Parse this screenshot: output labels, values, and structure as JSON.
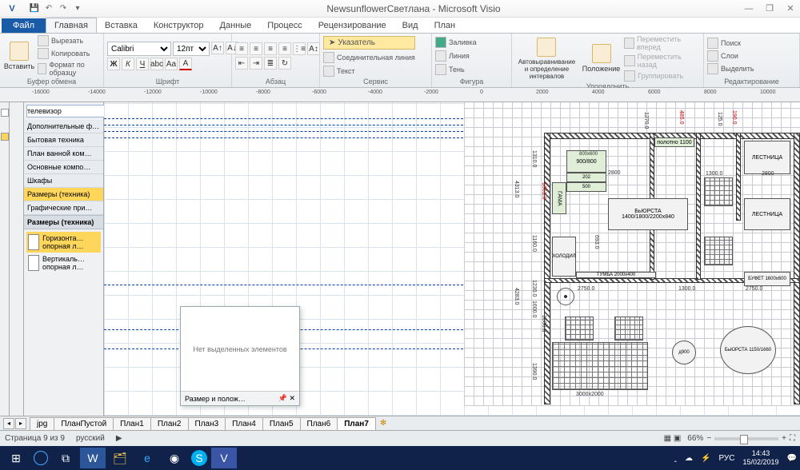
{
  "title": "NewsunflowerСветлана - Microsoft Visio",
  "file_tab": "Файл",
  "ribbon_tabs": [
    "Главная",
    "Вставка",
    "Конструктор",
    "Данные",
    "Процесс",
    "Рецензирование",
    "Вид",
    "План"
  ],
  "groups": {
    "clipboard": {
      "label": "Буфер обмена",
      "paste": "Вставить",
      "cut": "Вырезать",
      "copy": "Копировать",
      "format": "Формат по образцу"
    },
    "font": {
      "label": "Шрифт",
      "name": "Calibri",
      "size": "12пт"
    },
    "para": {
      "label": "Абзац"
    },
    "service": {
      "label": "Сервис",
      "pointer": "Указатель",
      "connector": "Соединительная линия",
      "text": "Текст"
    },
    "figure": {
      "label": "Фигура",
      "fill": "Заливка",
      "line": "Линия",
      "shadow": "Тень"
    },
    "arrange": {
      "label": "Упорядочить",
      "auto": "Автовыравнивание и определение интервалов",
      "pos": "Положение",
      "forward": "Переместить вперед",
      "back": "Переместить назад",
      "group": "Группировать"
    },
    "edit": {
      "label": "Редактирование",
      "find": "Поиск",
      "layers": "Слои",
      "select": "Выделить"
    }
  },
  "search_value": "телевизор",
  "stencil_cats": [
    "Дополнительные фи…",
    "Бытовая техника",
    "План ванной ком…",
    "Основные компо…",
    "Шкафы",
    "Размеры (техника)",
    "Графические при…"
  ],
  "stencil_header": "Размеры (техника)",
  "shapes": [
    {
      "n": "Горизонта… опорная л…"
    },
    {
      "n": "Вертикаль… опорная л…"
    }
  ],
  "float": {
    "msg": "Нет выделенных элементов",
    "title": "Размер и полож…"
  },
  "ruler_marks": [
    "-16000",
    "-14000",
    "-12000",
    "-10000",
    "-8000",
    "-6000",
    "-4000",
    "-2000",
    "0",
    "2000",
    "4000",
    "6000",
    "8000",
    "10000"
  ],
  "page_tabs": [
    "jpg",
    "ПланПустой",
    "План1",
    "План2",
    "План3",
    "План4",
    "План5",
    "План6",
    "План7"
  ],
  "active_page": "План7",
  "status": {
    "page": "Страница 9 из 9",
    "lang": "русский",
    "zoom": "66%"
  },
  "plan": {
    "stairs": "ЛЕСТНИЦА",
    "tumba": "ТУМБА 2000x400",
    "fridge": "ХОЛОДИЛ",
    "byursta": "БьЮРСТА 1400/1800/2200x840",
    "byursta2": "БьЮРСТА 1150/1660",
    "bufet": "БУФЕТ 1600x600",
    "polotno": "полотно 1100",
    "haga": "ГАМА",
    "d": "д900",
    "dims": {
      "w1": "2750.0",
      "w2": "2750.0",
      "w3": "1300.0",
      "w4": "1300.0",
      "w5": "1230.0",
      "h1": "4283.0",
      "h2": "1600.0",
      "h3": "1160.0",
      "h4": "1390.0",
      "h5": "1310.0",
      "h6": "4313.0",
      "r1": "2800",
      "r2": "2800",
      "t1": "1270.0",
      "t2": "125.0",
      "d1": "800x600",
      "d2": "3000x2000",
      "d3": "693.0",
      "d4": "1600.0",
      "g1": "1663.0",
      "g2": "900/800",
      "g3": "202",
      "g4": "500",
      "r3": "190.0",
      "r4": "485.0"
    }
  },
  "taskbar": {
    "time": "14:43",
    "date": "15/02/2019",
    "lang": "РУС"
  }
}
